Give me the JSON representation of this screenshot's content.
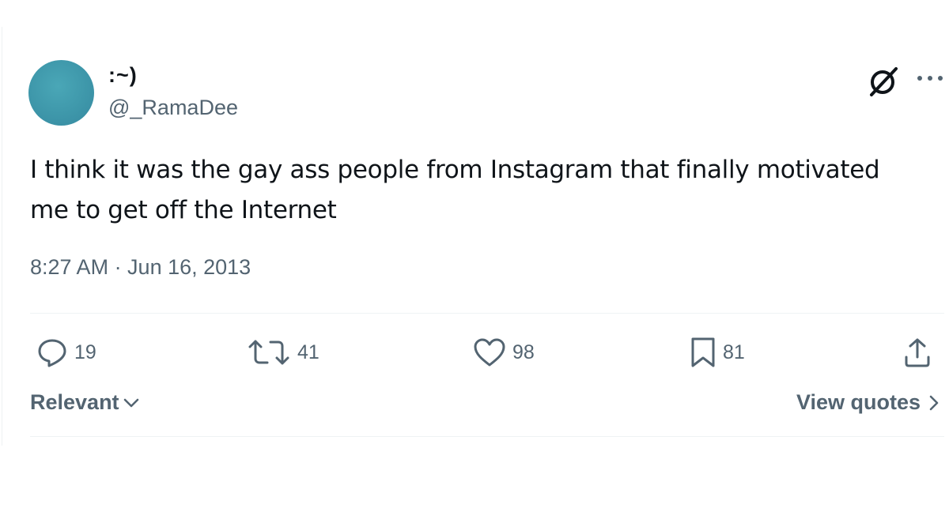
{
  "tweet": {
    "display_name": ":~)",
    "handle": "@_RamaDee",
    "text_line1": "I think it was the gay ass people from Instagram that finally motivated",
    "text_line2": "me to get off the Internet",
    "timestamp": "8:27 AM · Jun 16, 2013"
  },
  "icons": {
    "header": [
      "grok-icon",
      "more-icon"
    ],
    "actions": [
      "reply-icon",
      "retweet-icon",
      "like-icon",
      "bookmark-icon",
      "share-icon"
    ]
  },
  "actions": {
    "replies": "19",
    "retweets": "41",
    "likes": "98",
    "bookmarks": "81"
  },
  "footer": {
    "sort_label": "Relevant",
    "view_quotes_label": "View quotes"
  },
  "colors": {
    "avatar": "#3e97aa",
    "secondary_text": "#536471",
    "primary_text": "#0f1419"
  }
}
